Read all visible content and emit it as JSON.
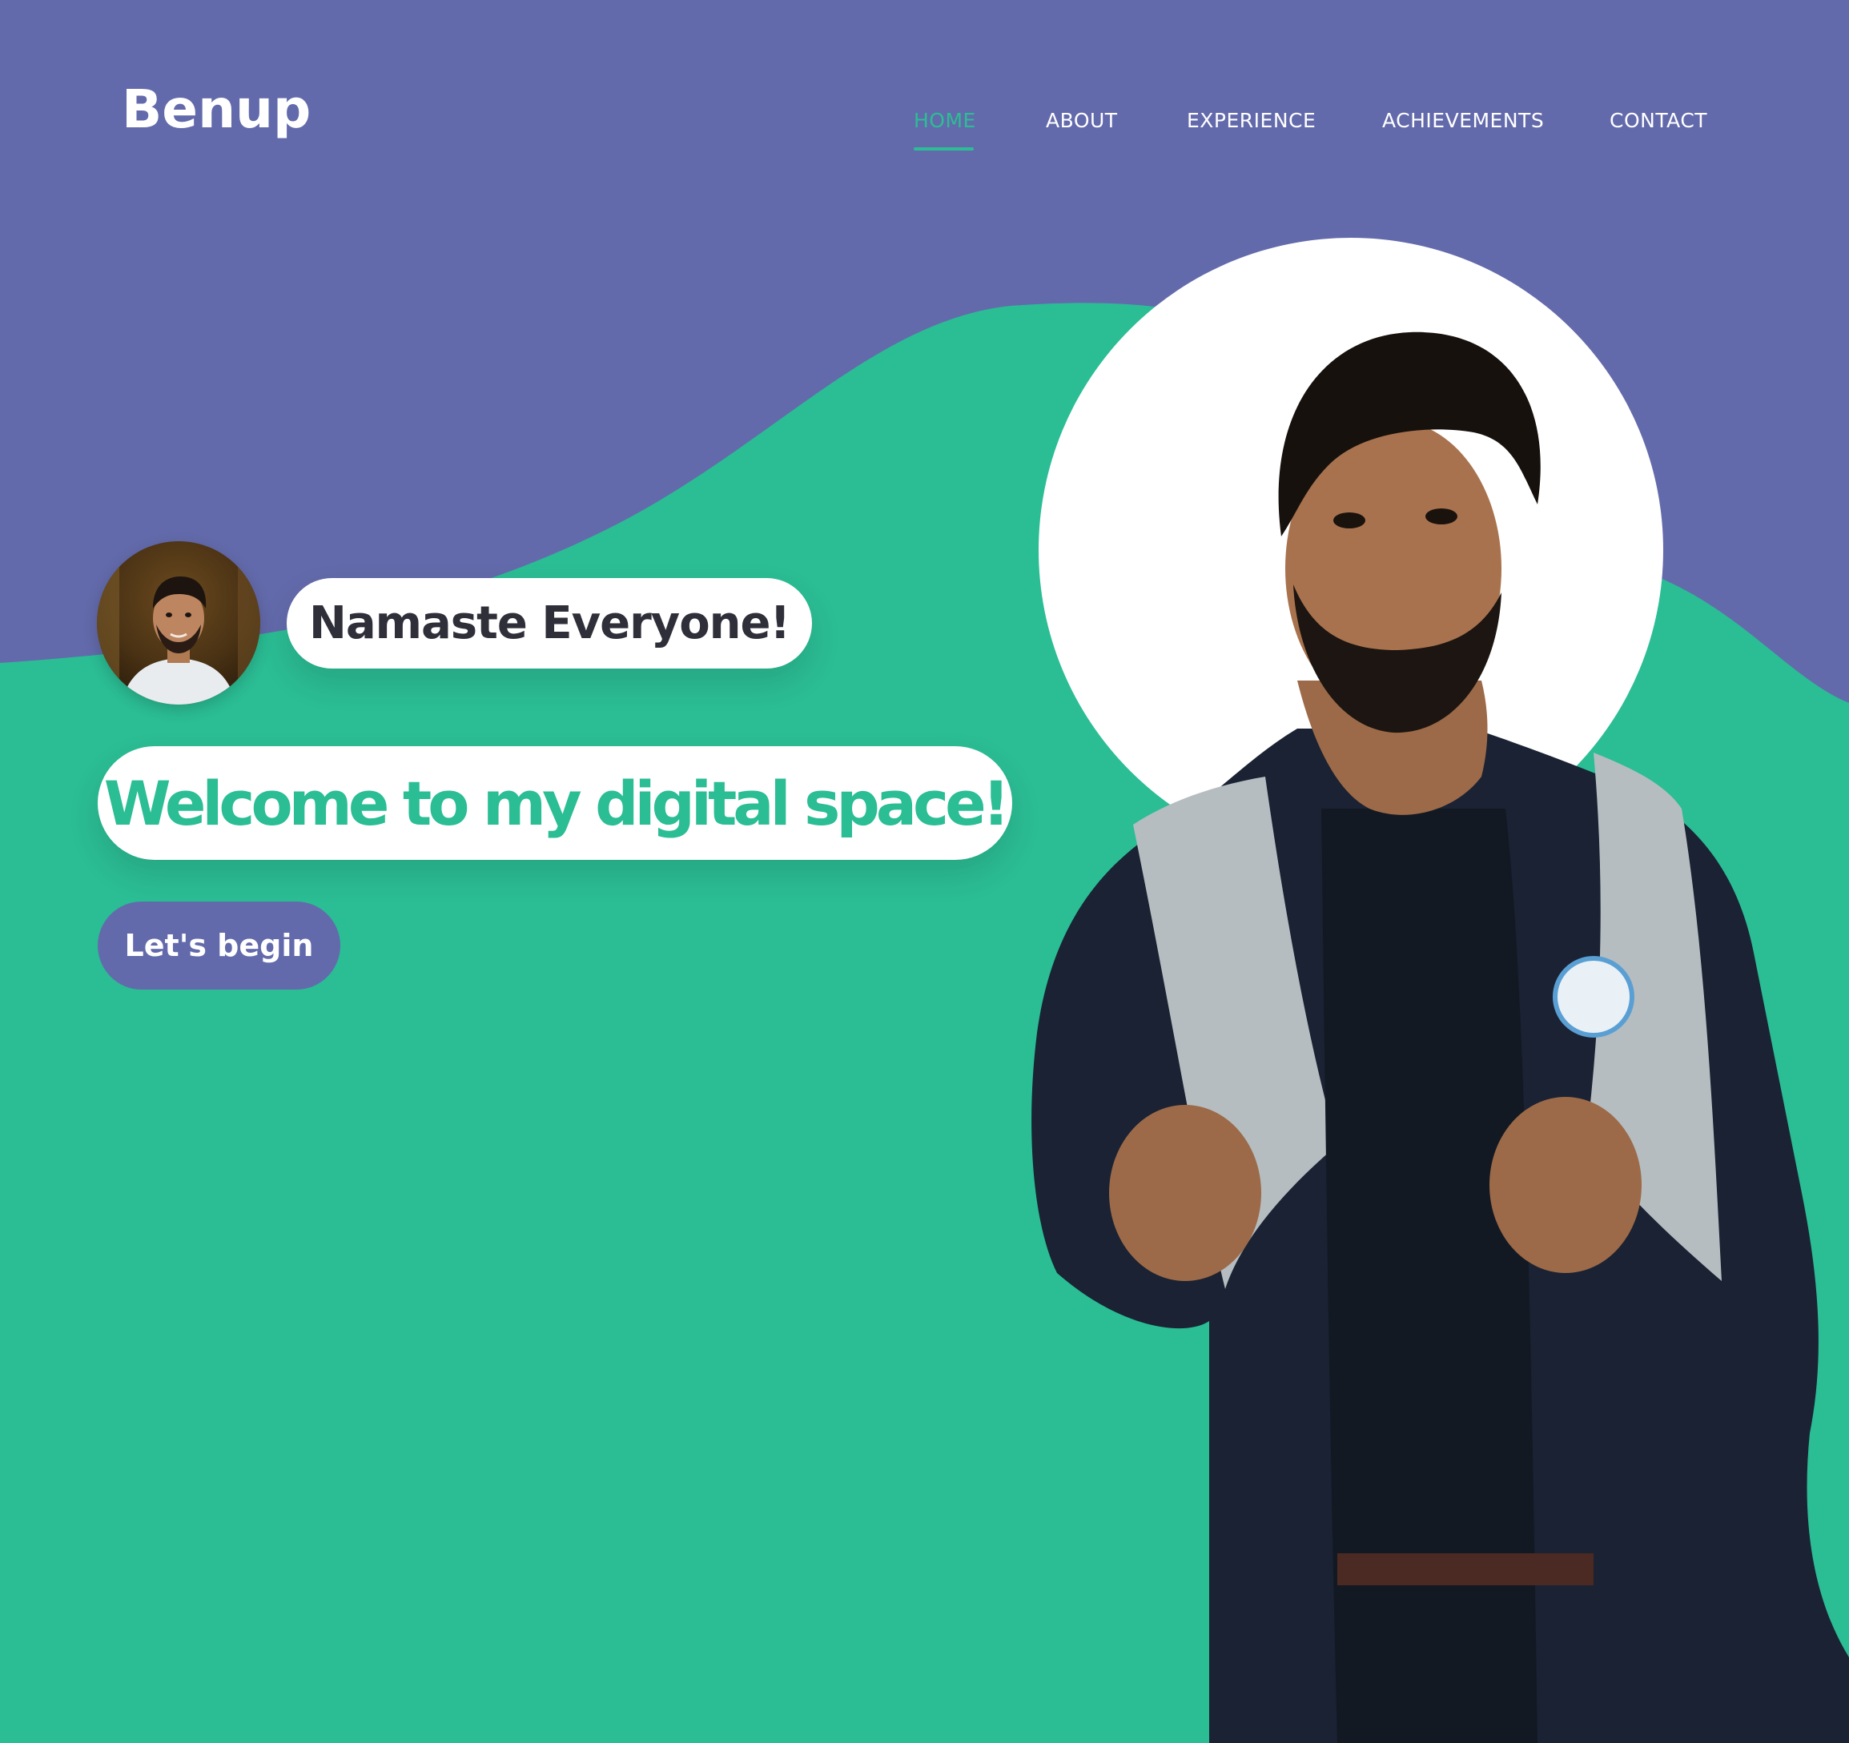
{
  "header": {
    "logo": "Benup"
  },
  "nav": {
    "items": [
      {
        "label": "HOME",
        "active": true
      },
      {
        "label": "ABOUT",
        "active": false
      },
      {
        "label": "EXPERIENCE",
        "active": false
      },
      {
        "label": "ACHIEVEMENTS",
        "active": false
      },
      {
        "label": "CONTACT",
        "active": false
      }
    ]
  },
  "hero": {
    "greeting": "Namaste Everyone!",
    "welcome": "Welcome to my digital space!",
    "cta_label": "Let's begin"
  },
  "colors": {
    "purple": "#636aab",
    "green": "#2bbd94",
    "white": "#ffffff",
    "dark_text": "#2f2f3a"
  }
}
